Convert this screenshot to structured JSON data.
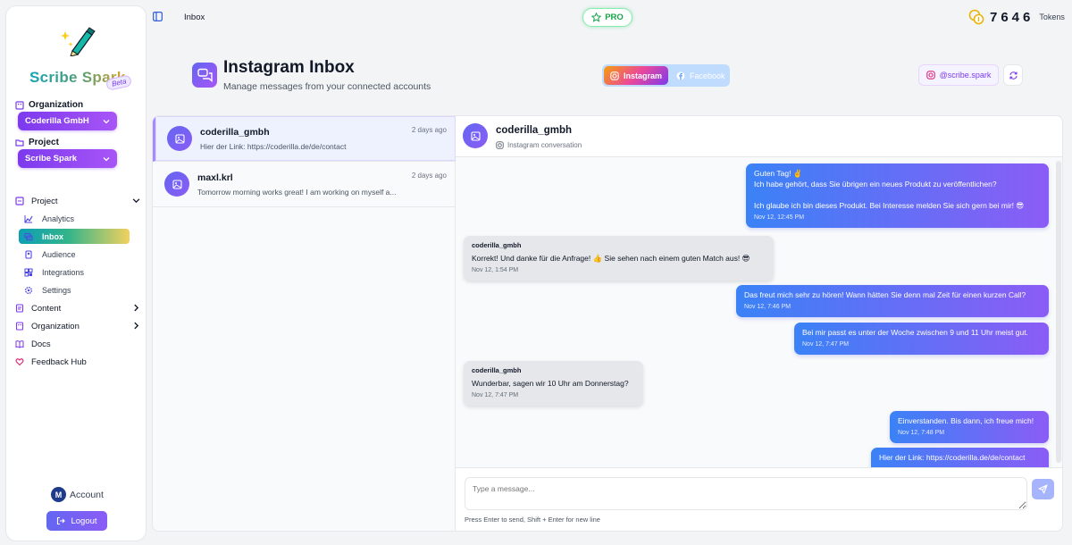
{
  "app": {
    "name": "Scribe Spark",
    "beta": "Beta"
  },
  "sidebar": {
    "org_label": "Organization",
    "org_value": "Coderilla GmbH",
    "project_label": "Project",
    "project_value": "Scribe Spark",
    "nav": {
      "project": "Project",
      "sub": [
        {
          "label": "Analytics",
          "icon": "chart-icon"
        },
        {
          "label": "Inbox",
          "icon": "inbox-icon",
          "active": true
        },
        {
          "label": "Audience",
          "icon": "audience-icon"
        },
        {
          "label": "Integrations",
          "icon": "integrations-icon"
        },
        {
          "label": "Settings",
          "icon": "settings-icon"
        }
      ],
      "content": "Content",
      "organization": "Organization",
      "docs": "Docs",
      "feedback": "Feedback Hub"
    },
    "account": {
      "initial": "M",
      "label": "Account"
    },
    "logout": "Logout"
  },
  "topbar": {
    "breadcrumb": "Inbox",
    "pro": "PRO",
    "tokens_value": "7646",
    "tokens_label": "Tokens"
  },
  "header": {
    "title": "Instagram Inbox",
    "subtitle": "Manage messages from your connected accounts",
    "platforms": [
      "Instagram",
      "Facebook"
    ],
    "active_platform": "Instagram",
    "account_handle": "@scribe.spark"
  },
  "conversations": [
    {
      "name": "coderilla_gmbh",
      "time": "2 days ago",
      "preview": "Hier der Link: https://coderilla.de/de/contact",
      "selected": true
    },
    {
      "name": "maxl.krl",
      "time": "2 days ago",
      "preview": "Tomorrow morning works great! I am working on myself a...",
      "selected": false
    }
  ],
  "chat": {
    "name": "coderilla_gmbh",
    "subtitle": "Instagram conversation",
    "messages": [
      {
        "dir": "out",
        "lines": [
          "Guten Tag! ✌️",
          "Ich habe gehört, dass Sie übrigen ein neues Produkt zu veröffentlichen?",
          "",
          "Ich glaube ich bin dieses Produkt. Bei Interesse melden Sie sich gern bei mir! 😎"
        ],
        "time": "Nov 12, 12:45 PM"
      },
      {
        "dir": "in",
        "sender": "coderilla_gmbh",
        "lines": [
          "Korrekt! Und danke für die Anfrage! 👍 Sie sehen nach einem guten Match aus! 😎"
        ],
        "time": "Nov 12, 1:54 PM"
      },
      {
        "dir": "out",
        "lines": [
          "Das freut mich sehr zu hören! Wann hätten Sie denn mal Zeit für einen kurzen Call?"
        ],
        "time": "Nov 12, 7:46 PM"
      },
      {
        "dir": "out",
        "lines": [
          "Bei mir passt es unter der Woche zwischen 9 und 11 Uhr meist gut."
        ],
        "time": "Nov 12, 7:47 PM"
      },
      {
        "dir": "in",
        "sender": "coderilla_gmbh",
        "lines": [
          "Wunderbar, sagen wir 10 Uhr am Donnerstag?"
        ],
        "time": "Nov 12, 7:47 PM"
      },
      {
        "dir": "out",
        "lines": [
          "Einverstanden. Bis dann, ich freue mich!"
        ],
        "time": "Nov 12, 7:48 PM"
      },
      {
        "dir": "out",
        "lines": [
          "Hier der Link: https://coderilla.de/de/contact"
        ],
        "time": ""
      }
    ]
  },
  "composer": {
    "placeholder": "Type a message...",
    "hint": "Press Enter to send, Shift + Enter for new line"
  },
  "colors": {
    "accent": "#7c3aed",
    "brand_blue": "#3b82f6",
    "pro_green": "#16a34a"
  }
}
